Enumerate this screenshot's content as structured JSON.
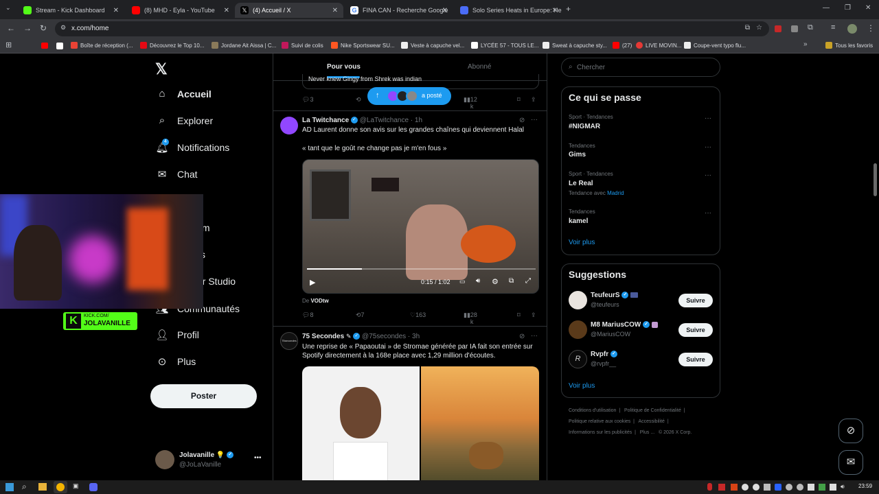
{
  "tabs": [
    {
      "title": "Stream - Kick Dashboard",
      "color": "#53fc18"
    },
    {
      "title": "(8) MHD - Eyla - YouTube",
      "color": "#ff0000"
    },
    {
      "title": "(4) Accueil / X",
      "color": "#ffffff"
    },
    {
      "title": "FINA CAN - Recherche Google",
      "color": "#4285f4"
    },
    {
      "title": "Solo Series Heats in Europe: He",
      "color": "#4a6cf7"
    }
  ],
  "address": "x.com/home",
  "bookmarks": [
    "Boîte de réception (...",
    "Découvrez le Top 10...",
    "Jordane Ait Aissa | C...",
    "Suivi de colis",
    "Nike Sportswear SU...",
    "Veste à capuche vel...",
    "LYCÉE 57 - TOUS LE...",
    "Sweat à capuche sty...",
    "(27)",
    "LIVE MOVIN...",
    "Coupe-vent typo flu...",
    "Tous les favoris"
  ],
  "nav": {
    "home": "Accueil",
    "explore": "Explorer",
    "notifications": "Notifications",
    "notif_badge": "4",
    "chat": "Chat",
    "premium_partial": "ium",
    "lists_partial": "s",
    "studio_partial": "or Studio",
    "communities": "Communautés",
    "profile": "Profil",
    "more": "Plus",
    "post_button": "Poster"
  },
  "account": {
    "name": "Jolavanille",
    "handle": "@JoLaVanille",
    "emoji": "💡"
  },
  "overlay": {
    "kick_line1": "KICK.COM/",
    "kick_line2": "JOLAVANILLE",
    "kick_letter": "K"
  },
  "timeline": {
    "tab_for_you": "Pour vous",
    "tab_following": "Abonné",
    "prev_text": "Never knew Gingy from Shrek was indian",
    "prev_actions": {
      "replies": "3",
      "views": "12 k"
    },
    "posted_pill": "a posté"
  },
  "post1": {
    "author": "La Twitchance",
    "handle": "@LaTwitchance",
    "time": "· 1h",
    "text": "AD Laurent donne son avis sur les grandes chaînes qui deviennent Halal",
    "quote": "« tant que le goût ne change pas je m'en fous »",
    "video_time": "0:15 / 1:02",
    "video_progress": 0.24,
    "source_label": "De",
    "source_name": "VODtw",
    "replies": "8",
    "reposts": "7",
    "likes": "163",
    "views": "28 k"
  },
  "post2": {
    "author": "75 Secondes",
    "handle": "@75secondes",
    "time": "· 3h",
    "text": "Une reprise de « Papaoutai » de Stromae générée par IA fait son entrée sur Spotify directement à la 168e place avec 1,29 million d'écoutes.",
    "avatar_text": "75secondes"
  },
  "search": {
    "placeholder": "Chercher"
  },
  "trends": {
    "title": "Ce qui se passe",
    "items": [
      {
        "category": "Sport · Tendances",
        "name": "#NIGMAR",
        "extra": ""
      },
      {
        "category": "Tendances",
        "name": "Gims",
        "extra": ""
      },
      {
        "category": "Sport · Tendances",
        "name": "Le Real",
        "extra": "Tendance avec"
      },
      {
        "category": "Tendances",
        "name": "kamel",
        "extra": ""
      }
    ],
    "extra_link": "Madrid",
    "more": "Voir plus"
  },
  "suggestions": {
    "title": "Suggestions",
    "follow_label": "Suivre",
    "items": [
      {
        "name": "TeufeurS",
        "handle": "@teufeurs"
      },
      {
        "name": "M8 MariusCOW",
        "handle": "@MariusCOW"
      },
      {
        "name": "Rvpfr",
        "handle": "@rvpfr__"
      }
    ],
    "more": "Voir plus"
  },
  "footer": {
    "l1": "Conditions d'utilisation",
    "l2": "Politique de Confidentialité",
    "l3": "Politique relative aux cookies",
    "l4": "Accessibilité",
    "l5": "Informations sur les publicités",
    "l6": "Plus ...",
    "l7": "© 2026 X Corp."
  },
  "taskbar": {
    "clock": "23:59"
  }
}
